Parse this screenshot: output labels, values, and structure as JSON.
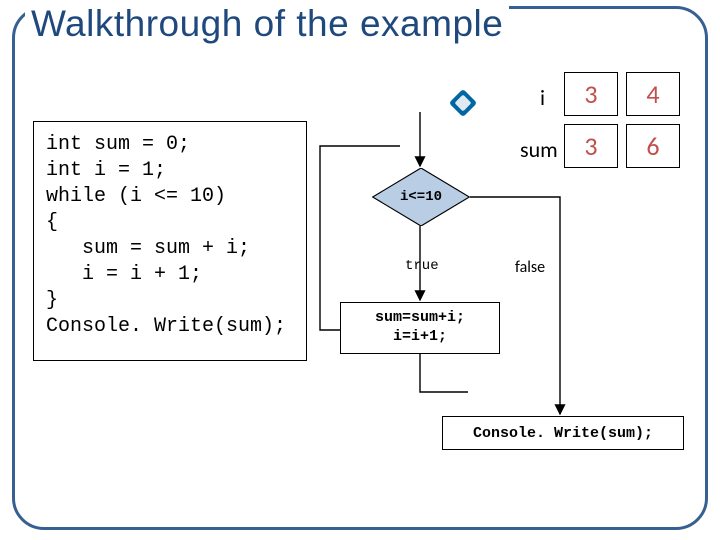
{
  "title": "Walkthrough of the example",
  "code": {
    "l1": "int sum = 0;",
    "l2": "int i = 1;",
    "l3": "while (i <= 10)",
    "l4": "{",
    "l5": "   sum = sum + i;",
    "l6": "   i = i + 1;",
    "l7": "}",
    "l8": "Console. Write(sum);"
  },
  "vars": {
    "i_label": "i",
    "sum_label": "sum",
    "i_prev": "3",
    "i_next": "4",
    "sum_prev": "3",
    "sum_next": "6"
  },
  "flow": {
    "condition": "i<=10",
    "true_label": "true",
    "false_label": "false",
    "process_l1": "sum=sum+i;",
    "process_l2": "i=i+1;",
    "final": "Console. Write(sum);"
  }
}
